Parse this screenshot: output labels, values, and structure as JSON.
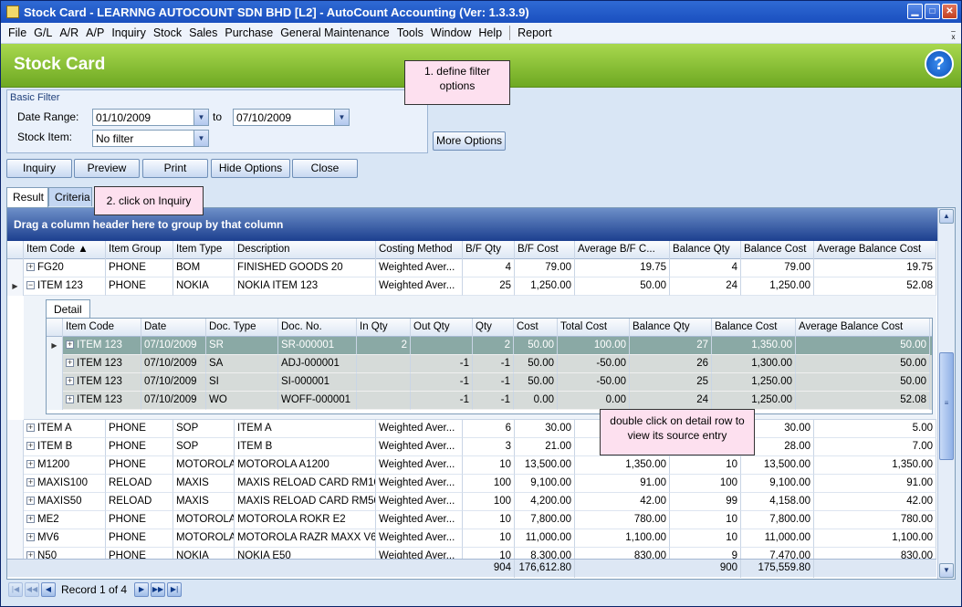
{
  "window": {
    "title": "Stock Card - LEARNNG AUTOCOUNT SDN BHD [L2] - AutoCount Accounting (Ver: 1.3.3.9)"
  },
  "menu": [
    "File",
    "G/L",
    "A/R",
    "A/P",
    "Inquiry",
    "Stock",
    "Sales",
    "Purchase",
    "General Maintenance",
    "Tools",
    "Window",
    "Help",
    "Report"
  ],
  "header": {
    "title": "Stock Card",
    "help": "?"
  },
  "callouts": {
    "c1": "1. define filter options",
    "c2": "2. click on Inquiry",
    "c3": "double click on detail row to view its source entry"
  },
  "filter": {
    "group_label": "Basic Filter",
    "date_range_label": "Date Range:",
    "date_from": "01/10/2009",
    "to_label": "to",
    "date_to": "07/10/2009",
    "stock_item_label": "Stock Item:",
    "stock_item": "No filter",
    "more_options": "More Options"
  },
  "toolbar": {
    "inquiry": "Inquiry",
    "preview": "Preview",
    "print": "Print",
    "hide_options": "Hide Options",
    "close": "Close"
  },
  "tabs": {
    "result": "Result",
    "criteria": "Criteria"
  },
  "grid": {
    "group_prompt": "Drag a column header here to group by that column",
    "columns": [
      "Item Code",
      "Item Group",
      "Item Type",
      "Description",
      "Costing Method",
      "B/F Qty",
      "B/F Cost",
      "Average B/F C...",
      "Balance Qty",
      "Balance Cost",
      "Average Balance Cost"
    ],
    "rows": [
      [
        "FG20",
        "PHONE",
        "BOM",
        "FINISHED GOODS 20",
        "Weighted Aver...",
        "4",
        "79.00",
        "19.75",
        "4",
        "79.00",
        "19.75"
      ],
      [
        "ITEM 123",
        "PHONE",
        "NOKIA",
        "NOKIA ITEM 123",
        "Weighted Aver...",
        "25",
        "1,250.00",
        "50.00",
        "24",
        "1,250.00",
        "52.08"
      ],
      [
        "ITEM A",
        "PHONE",
        "SOP",
        "ITEM A",
        "Weighted Aver...",
        "6",
        "30.00",
        "",
        "",
        "30.00",
        "5.00"
      ],
      [
        "ITEM B",
        "PHONE",
        "SOP",
        "ITEM B",
        "Weighted Aver...",
        "3",
        "21.00",
        "",
        "",
        "28.00",
        "7.00"
      ],
      [
        "M1200",
        "PHONE",
        "MOTOROLA",
        "MOTOROLA A1200",
        "Weighted Aver...",
        "10",
        "13,500.00",
        "1,350.00",
        "10",
        "13,500.00",
        "1,350.00"
      ],
      [
        "MAXIS100",
        "RELOAD",
        "MAXIS",
        "MAXIS RELOAD CARD RM100",
        "Weighted Aver...",
        "100",
        "9,100.00",
        "91.00",
        "100",
        "9,100.00",
        "91.00"
      ],
      [
        "MAXIS50",
        "RELOAD",
        "MAXIS",
        "MAXIS RELOAD CARD RM50",
        "Weighted Aver...",
        "100",
        "4,200.00",
        "42.00",
        "99",
        "4,158.00",
        "42.00"
      ],
      [
        "ME2",
        "PHONE",
        "MOTOROLA",
        "MOTOROLA ROKR E2",
        "Weighted Aver...",
        "10",
        "7,800.00",
        "780.00",
        "10",
        "7,800.00",
        "780.00"
      ],
      [
        "MV6",
        "PHONE",
        "MOTOROLA",
        "MOTOROLA RAZR MAXX V6",
        "Weighted Aver...",
        "10",
        "11,000.00",
        "1,100.00",
        "10",
        "11,000.00",
        "1,100.00"
      ],
      [
        "N50",
        "PHONE",
        "NOKIA",
        "NOKIA E50",
        "Weighted Aver...",
        "10",
        "8,300.00",
        "830.00",
        "9",
        "7,470.00",
        "830.00"
      ]
    ],
    "footer": {
      "bf_qty": "904",
      "bf_cost": "176,612.80",
      "bal_qty": "900",
      "bal_cost": "175,559.80"
    },
    "detail": {
      "tab": "Detail",
      "columns": [
        "Item Code",
        "Date",
        "Doc. Type",
        "Doc. No.",
        "In Qty",
        "Out Qty",
        "Qty",
        "Cost",
        "Total Cost",
        "Balance Qty",
        "Balance Cost",
        "Average Balance Cost"
      ],
      "rows": [
        [
          "ITEM 123",
          "07/10/2009",
          "SR",
          "SR-000001",
          "2",
          "",
          "2",
          "50.00",
          "100.00",
          "27",
          "1,350.00",
          "50.00"
        ],
        [
          "ITEM 123",
          "07/10/2009",
          "SA",
          "ADJ-000001",
          "",
          "-1",
          "-1",
          "50.00",
          "-50.00",
          "26",
          "1,300.00",
          "50.00"
        ],
        [
          "ITEM 123",
          "07/10/2009",
          "SI",
          "SI-000001",
          "",
          "-1",
          "-1",
          "50.00",
          "-50.00",
          "25",
          "1,250.00",
          "50.00"
        ],
        [
          "ITEM 123",
          "07/10/2009",
          "WO",
          "WOFF-000001",
          "",
          "-1",
          "-1",
          "0.00",
          "0.00",
          "24",
          "1,250.00",
          "52.08"
        ]
      ]
    }
  },
  "nav": {
    "record": "Record 1 of 4"
  }
}
